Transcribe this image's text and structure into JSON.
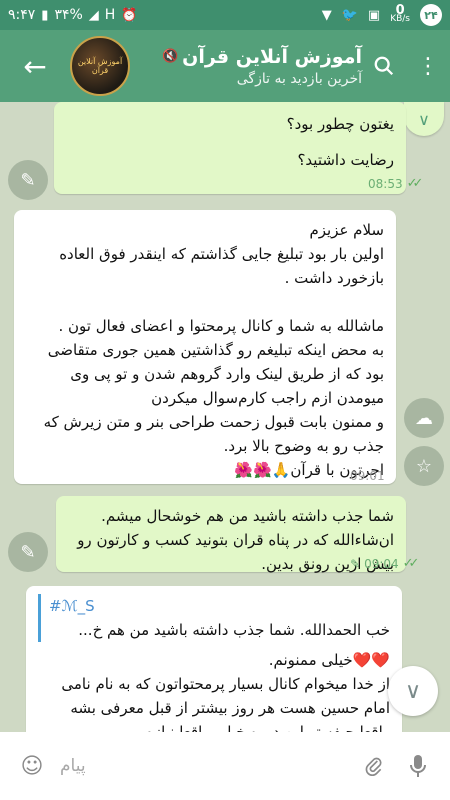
{
  "status_bar": {
    "time": "۹:۴۷",
    "battery": "۳۴%",
    "network": "H",
    "speed_value": "0",
    "speed_unit": "KB/s",
    "notification_count": "۲۴"
  },
  "header": {
    "title": "آموزش آنلاین قرآن",
    "subtitle": "آخرین بازدید به تازگی",
    "avatar_text": "آموزش آنلاین قرآن"
  },
  "messages": [
    {
      "lines": [
        "یغتون چطور بود؟",
        "رضایت داشتید؟"
      ],
      "time": "08:53"
    },
    {
      "lines": [
        "سلام عزیزم",
        "اولین بار بود تبلیغ جایی گذاشتم که اینقدر فوق العاده بازخورد داشت .",
        "",
        "ماشالله به شما و کانال پرمحتوا و اعضای فعال تون .",
        "به محض اینکه تبلیغم  رو گذاشتین همین جوری متقاضی بود که از طریق لینک وارد گروهم شدن و تو پی وی میومدن ازم راجب کارم‌سوال میکردن",
        "و ممنون بابت قبول زحمت طراحی بنر  و متن زیرش که جذب رو به وضوح بالا برد.",
        "اجرتون با قرآن🙏🌺🌺"
      ],
      "time": "09:01"
    },
    {
      "lines": [
        "شما جذب داشته باشید من هم خوشحال میشم. ان‌شاءالله که در پناه قران بتونید کسب و کارتون رو بیش ازین رونق بدین."
      ],
      "time": "09:04"
    },
    {
      "reply_name": "#ℳ_S",
      "reply_text": "خب الحمدالله. شما جذب داشته باشید من هم خ...",
      "lines": [
        "❤️❤️خیلی ممنونم.",
        "از خدا میخوام کانال بسیار پرمحتواتون  که به نام نامی امام حسین هست هر روز بیشتر از قبل معرفی بشه واقعا حیفه تو این دوره خیلی واقعا نیازه."
      ]
    }
  ],
  "input": {
    "placeholder": "پیام"
  },
  "colors": {
    "header": "#54a07a",
    "status_bar": "#3f8f6e",
    "outgoing_bubble": "#e2f8c8",
    "incoming_bubble": "#ffffff",
    "chat_background": "#cfd9c4"
  }
}
